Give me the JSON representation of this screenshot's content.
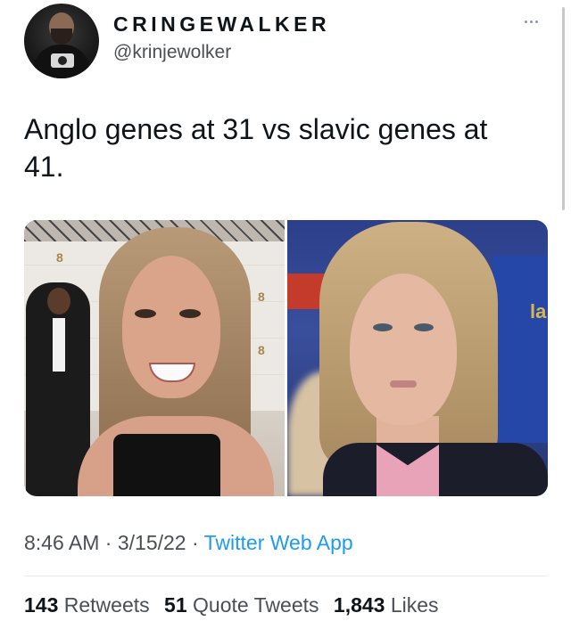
{
  "author": {
    "display_name": "CRINGEWALKER",
    "handle": "@krinjewolker"
  },
  "tweet": {
    "text_line1": "Anglo genes at 31 vs slavic genes at",
    "text_line2": "41."
  },
  "media": {
    "left_logo_marks": [
      "8",
      "8",
      "8",
      "8",
      "8",
      "8",
      "8"
    ],
    "right_mark": "la"
  },
  "meta": {
    "time": "8:46 AM",
    "separator1": " · ",
    "date": "3/15/22",
    "separator2": " · ",
    "source": "Twitter Web App"
  },
  "stats": {
    "retweets_count": "143",
    "retweets_label": "Retweets",
    "quotes_count": "51",
    "quotes_label": "Quote Tweets",
    "likes_count": "1,843",
    "likes_label": "Likes"
  },
  "colors": {
    "link": "#1d9bf0",
    "text": "#0f1419",
    "secondary": "#4a4f55"
  },
  "icons": {
    "more": "more-dots-icon"
  }
}
